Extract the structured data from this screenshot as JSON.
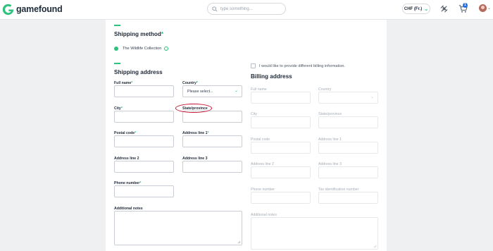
{
  "header": {
    "brand": "gamefound",
    "search_placeholder": "type something...",
    "currency": "CHF (Fr.)",
    "cart_count": "1"
  },
  "shipping_method": {
    "title": "Shipping method",
    "required_mark": "*",
    "option_label": "The Wildlife Collection",
    "info_icon": "i"
  },
  "shipping_address": {
    "title": "Shipping address",
    "full_name_label": "Full name",
    "country_label": "Country",
    "country_value": "Please select...",
    "city_label": "City",
    "state_label": "State/province",
    "postal_label": "Postal code",
    "address1_label": "Address line 1",
    "address2_label": "Address line 2",
    "address3_label": "Address line 3",
    "phone_label": "Phone number",
    "notes_label": "Additional notes",
    "required_mark": "*"
  },
  "billing": {
    "checkbox_label": "I would like to provide different billing information.",
    "title": "Billing address",
    "full_name_label": "Full name",
    "country_label": "Country",
    "city_label": "City",
    "state_label": "State/province",
    "postal_label": "Postal code",
    "address1_label": "Address line 1",
    "address2_label": "Address line 2",
    "address3_label": "Address line 3",
    "phone_label": "Phone number",
    "tax_label": "Tax identification number",
    "notes_label": "Additional notes"
  },
  "colors": {
    "accent": "#2ec27e",
    "annotation": "#c8102e",
    "badge": "#1f6feb"
  },
  "icons": [
    "gamefound-logo-icon",
    "search-icon",
    "chevron-down-icon",
    "rocket-icon",
    "cart-icon",
    "avatar",
    "info-icon"
  ]
}
